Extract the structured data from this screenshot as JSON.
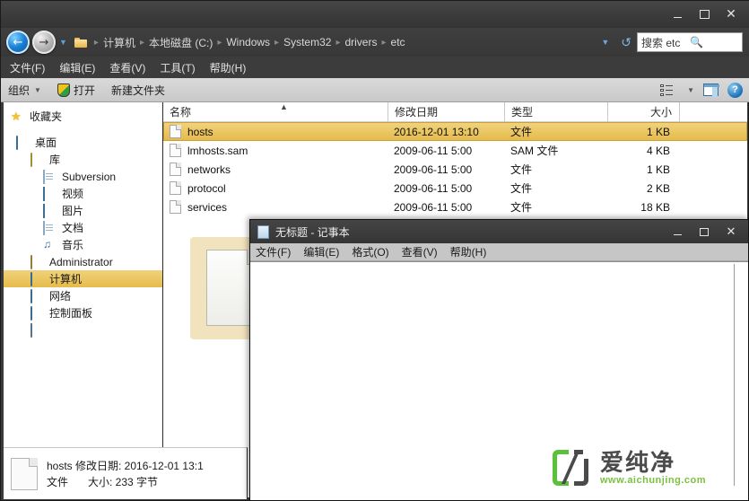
{
  "explorer": {
    "window_controls": {
      "minimize": "—",
      "maximize": "□",
      "close": "✕"
    },
    "nav": {
      "back_icon": "back-arrow",
      "forward_icon": "forward-arrow",
      "dropdown": "▼"
    },
    "breadcrumb": {
      "items": [
        "计算机",
        "本地磁盘 (C:)",
        "Windows",
        "System32",
        "drivers",
        "etc"
      ],
      "separator": "▸"
    },
    "address_right": {
      "chevron": "▼",
      "refresh": "↺"
    },
    "search": {
      "value": "搜索 etc",
      "icon": "search-icon"
    },
    "menubar": [
      "文件(F)",
      "编辑(E)",
      "查看(V)",
      "工具(T)",
      "帮助(H)"
    ],
    "toolbar": {
      "organize": "组织",
      "organize_caret": "▼",
      "open": "打开",
      "new_folder": "新建文件夹",
      "help_glyph": "?"
    },
    "sidebar": {
      "items": [
        {
          "label": "收藏夹",
          "icon": "star-icon",
          "level": 0,
          "selected": false
        },
        {
          "label": "桌面",
          "icon": "desktop-icon",
          "level": 0,
          "selected": false
        },
        {
          "label": "库",
          "icon": "library-icon",
          "level": 1,
          "selected": false
        },
        {
          "label": "Subversion",
          "icon": "subversion-icon",
          "level": 2,
          "selected": false
        },
        {
          "label": "视频",
          "icon": "video-icon",
          "level": 2,
          "selected": false
        },
        {
          "label": "图片",
          "icon": "pictures-icon",
          "level": 2,
          "selected": false
        },
        {
          "label": "文档",
          "icon": "documents-icon",
          "level": 2,
          "selected": false
        },
        {
          "label": "音乐",
          "icon": "music-icon",
          "level": 2,
          "selected": false
        },
        {
          "label": "Administrator",
          "icon": "user-icon",
          "level": 1,
          "selected": false
        },
        {
          "label": "计算机",
          "icon": "computer-icon",
          "level": 1,
          "selected": true
        },
        {
          "label": "网络",
          "icon": "network-icon",
          "level": 1,
          "selected": false
        },
        {
          "label": "控制面板",
          "icon": "control-panel-icon",
          "level": 1,
          "selected": false
        },
        {
          "label": "",
          "icon": "recycle-bin-icon",
          "level": 1,
          "selected": false
        }
      ]
    },
    "filelist": {
      "columns": [
        "名称",
        "修改日期",
        "类型",
        "大小"
      ],
      "sort_indicator": "▲",
      "rows": [
        {
          "name": "hosts",
          "date": "2016-12-01 13:10",
          "type": "文件",
          "size": "1 KB",
          "selected": true
        },
        {
          "name": "lmhosts.sam",
          "date": "2009-06-11 5:00",
          "type": "SAM 文件",
          "size": "4 KB",
          "selected": false
        },
        {
          "name": "networks",
          "date": "2009-06-11 5:00",
          "type": "文件",
          "size": "1 KB",
          "selected": false
        },
        {
          "name": "protocol",
          "date": "2009-06-11 5:00",
          "type": "文件",
          "size": "2 KB",
          "selected": false
        },
        {
          "name": "services",
          "date": "2009-06-11 5:00",
          "type": "文件",
          "size": "18 KB",
          "selected": false
        }
      ]
    },
    "statusbar": {
      "line1": "hosts  修改日期: 2016-12-01 13:1",
      "type_label": "文件",
      "size_label": "大小: 233 字节"
    }
  },
  "notepad": {
    "title": "无标题 - 记事本",
    "window_controls": {
      "minimize": "—",
      "maximize": "□",
      "close": "✕"
    },
    "menubar": [
      "文件(F)",
      "编辑(E)",
      "格式(O)",
      "查看(V)",
      "帮助(H)"
    ],
    "content": ""
  },
  "annotation": {
    "drag_file_icon": "dragged-file-icon",
    "arrow": "curved-drag-arrow"
  },
  "watermark": {
    "brand": "爱纯净",
    "url": "www.aichunjing.com",
    "brand_color": "#7ac143"
  }
}
